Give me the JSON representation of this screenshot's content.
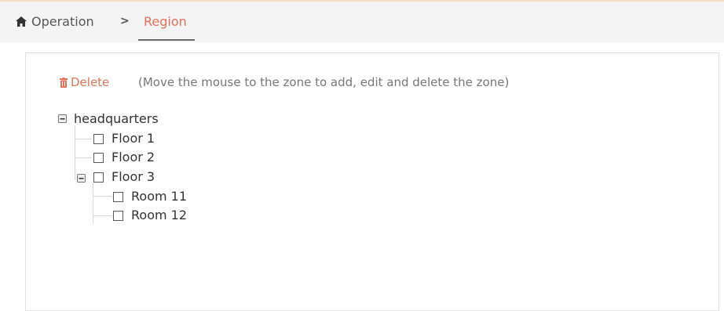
{
  "breadcrumb": {
    "items": [
      "Operation",
      "Region"
    ],
    "separator": ">"
  },
  "toolbar": {
    "delete_label": "Delete",
    "hint": "(Move the mouse to the zone to add, edit and delete the zone)"
  },
  "tree": {
    "root": "headquarters",
    "floor1": "Floor 1",
    "floor2": "Floor 2",
    "floor3": "Floor 3",
    "room11": "Room 11",
    "room12": "Room 12"
  },
  "colors": {
    "accent": "#e2725b",
    "breadcrumb_bg": "#f4f4f4",
    "text": "#333333"
  }
}
